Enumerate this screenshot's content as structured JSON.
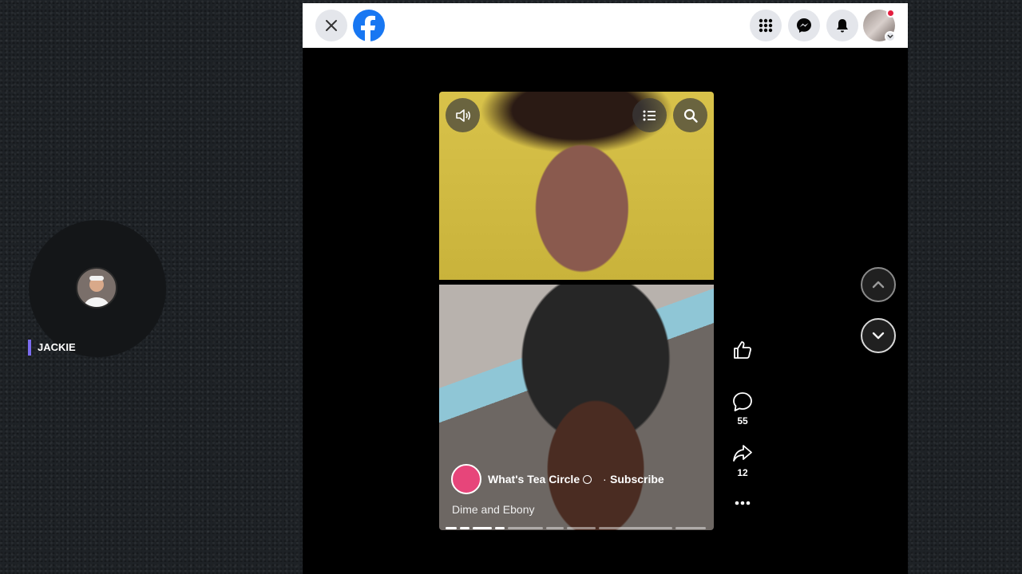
{
  "streamer": {
    "name": "JACKIE"
  },
  "facebook": {
    "header": {
      "icons": [
        "close-icon",
        "facebook-logo",
        "menu-grid-icon",
        "messenger-icon",
        "notifications-icon",
        "profile-avatar"
      ]
    },
    "reel": {
      "channel_name": "What's Tea Circle",
      "separator": "·",
      "subscribe_label": "Subscribe",
      "caption": "Dime and Ebony",
      "comments_count": "55",
      "shares_count": "12"
    },
    "colors": {
      "brand": "#1877f2",
      "notification_dot": "#e41e3f",
      "accent": "#7b6cf0"
    }
  }
}
